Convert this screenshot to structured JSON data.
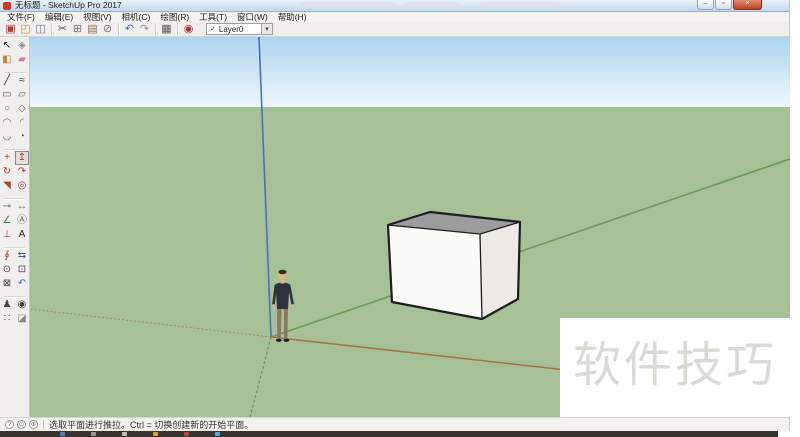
{
  "window": {
    "title": "无标题 - SketchUp Pro 2017",
    "controls": {
      "minimize": "–",
      "maximize": "▫",
      "close": "×"
    }
  },
  "menu": {
    "items": [
      {
        "id": "file",
        "label": "文件(F)"
      },
      {
        "id": "edit",
        "label": "编辑(E)"
      },
      {
        "id": "view",
        "label": "视图(V)"
      },
      {
        "id": "camera",
        "label": "相机(C)"
      },
      {
        "id": "draw",
        "label": "绘图(R)"
      },
      {
        "id": "tools",
        "label": "工具(T)"
      },
      {
        "id": "window",
        "label": "窗口(W)"
      },
      {
        "id": "help",
        "label": "帮助(H)"
      }
    ]
  },
  "toolbar": {
    "groups": [
      [
        {
          "name": "new",
          "glyph": "▣",
          "color": "#c23b2a"
        },
        {
          "name": "open",
          "glyph": "◰",
          "color": "#c8973f"
        },
        {
          "name": "save",
          "glyph": "◫",
          "color": "#6b7f9e"
        }
      ],
      [
        {
          "name": "cut",
          "glyph": "✂",
          "color": "#555555"
        },
        {
          "name": "copy",
          "glyph": "⊞",
          "color": "#777777"
        },
        {
          "name": "paste",
          "glyph": "▤",
          "color": "#8a6f4e"
        },
        {
          "name": "erase",
          "glyph": "⊘",
          "color": "#777777"
        }
      ],
      [
        {
          "name": "undo",
          "glyph": "↶",
          "color": "#3a6fc4"
        },
        {
          "name": "redo",
          "glyph": "↷",
          "color": "#9a9a9a"
        }
      ],
      [
        {
          "name": "print",
          "glyph": "▦",
          "color": "#555555"
        }
      ],
      [
        {
          "name": "model-info",
          "glyph": "◉",
          "color": "#b03030"
        }
      ]
    ],
    "layer_combo": {
      "check": "✓",
      "value": "Layer0",
      "arrow": "▾"
    }
  },
  "tool_palette": {
    "rows": [
      {
        "left": {
          "name": "select",
          "glyph": "↖",
          "color": "#111111"
        },
        "right": {
          "name": "make-component",
          "glyph": "◈",
          "color": "#888888"
        }
      },
      {
        "left": {
          "name": "paint-bucket",
          "glyph": "◧",
          "color": "#c77d2e"
        },
        "right": {
          "name": "eraser",
          "glyph": "▰",
          "color": "#d07a9a"
        }
      },
      {
        "sep": true
      },
      {
        "left": {
          "name": "line",
          "glyph": "╱",
          "color": "#333333"
        },
        "right": {
          "name": "freehand",
          "glyph": "≈",
          "color": "#333333"
        }
      },
      {
        "left": {
          "name": "rectangle",
          "glyph": "▭",
          "color": "#6b5d4f"
        },
        "right": {
          "name": "rotated-rectangle",
          "glyph": "▱",
          "color": "#6b5d4f"
        }
      },
      {
        "left": {
          "name": "circle",
          "glyph": "○",
          "color": "#6b5d4f"
        },
        "right": {
          "name": "polygon",
          "glyph": "◇",
          "color": "#6b5d4f"
        }
      },
      {
        "left": {
          "name": "arc",
          "glyph": "◠",
          "color": "#6b5d4f"
        },
        "right": {
          "name": "two-point-arc",
          "glyph": "◜",
          "color": "#6b5d4f"
        }
      },
      {
        "left": {
          "name": "three-point-arc",
          "glyph": "◡",
          "color": "#6b5d4f"
        },
        "right": {
          "name": "pie",
          "glyph": "◔",
          "color": "#6b5d4f"
        }
      },
      {
        "sep": true
      },
      {
        "left": {
          "name": "move",
          "glyph": "+",
          "color": "#c0392b"
        },
        "right": {
          "name": "push-pull",
          "glyph": "↥",
          "color": "#c0392b",
          "selected": true
        }
      },
      {
        "left": {
          "name": "rotate",
          "glyph": "↻",
          "color": "#c0392b"
        },
        "right": {
          "name": "follow-me",
          "glyph": "↷",
          "color": "#c0392b"
        }
      },
      {
        "left": {
          "name": "scale",
          "glyph": "◥",
          "color": "#c0392b"
        },
        "right": {
          "name": "offset",
          "glyph": "◎",
          "color": "#8a3a3a"
        }
      },
      {
        "sep": true
      },
      {
        "left": {
          "name": "tape-measure",
          "glyph": "⊸",
          "color": "#4a7d4a"
        },
        "right": {
          "name": "dimension",
          "glyph": "↔",
          "color": "#4a7d4a"
        }
      },
      {
        "left": {
          "name": "protractor",
          "glyph": "∠",
          "color": "#4a7d4a"
        },
        "right": {
          "name": "text",
          "glyph": "Ⓐ",
          "color": "#666666"
        }
      },
      {
        "left": {
          "name": "axes",
          "glyph": "⊥",
          "color": "#b04a4a"
        },
        "right": {
          "name": "three-d-text",
          "glyph": "A",
          "color": "#222222"
        }
      },
      {
        "sep": true
      },
      {
        "left": {
          "name": "orbit",
          "glyph": "∮",
          "color": "#b03a2a"
        },
        "right": {
          "name": "pan",
          "glyph": "⇆",
          "color": "#3a5a9a"
        }
      },
      {
        "left": {
          "name": "zoom",
          "glyph": "⊙",
          "color": "#444444"
        },
        "right": {
          "name": "zoom-window",
          "glyph": "⊡",
          "color": "#444444"
        }
      },
      {
        "left": {
          "name": "zoom-extents",
          "glyph": "⊠",
          "color": "#444444"
        },
        "right": {
          "name": "previous",
          "glyph": "↶",
          "color": "#3a6fc4"
        }
      },
      {
        "sep": true
      },
      {
        "left": {
          "name": "position-camera",
          "glyph": "♟",
          "color": "#444444"
        },
        "right": {
          "name": "look-around",
          "glyph": "◉",
          "color": "#444444"
        }
      },
      {
        "left": {
          "name": "walk",
          "glyph": "∷",
          "color": "#444444"
        },
        "right": {
          "name": "section-plane",
          "glyph": "◪",
          "color": "#888888"
        }
      }
    ]
  },
  "viewport": {
    "watermark": "软件技巧",
    "colors": {
      "sky_top": "#aed4ee",
      "sky_bottom": "#eef7fd",
      "ground": "#a6c198",
      "axis_blue": "#4a6fbf",
      "axis_green": "#6b9b58",
      "axis_red": "#a8714a",
      "box_top": "#9c9c9c",
      "box_front": "#fbfbf8",
      "box_right": "#eceae4",
      "edge": "#1d1d1d",
      "watermark_text": "#d9dcd4"
    }
  },
  "status_bar": {
    "icons": [
      {
        "name": "help-status-icon",
        "glyph": "?"
      },
      {
        "name": "geolocation-status-icon",
        "glyph": "⊙"
      },
      {
        "name": "credits-status-icon",
        "glyph": "⊕"
      }
    ],
    "message": "选取平面进行推拉。Ctrl = 切换创建新的开始平面。"
  },
  "taskbar": {
    "icon_colors": [
      "#4a84c8",
      "#9a9a9a",
      "#c8c0b0",
      "#d9a43a",
      "#c44333",
      "#58a8d8"
    ]
  }
}
